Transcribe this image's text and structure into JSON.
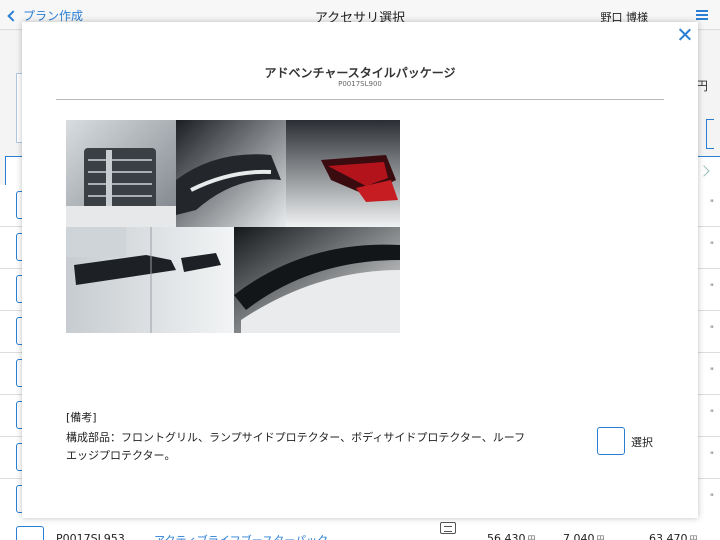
{
  "header": {
    "back_label": "プラン作成",
    "title": "アクセサリ選択",
    "user": "野口 博様"
  },
  "background": {
    "yen_label": "円",
    "row_unit": "\"",
    "bottom_row": {
      "code": "P0017SL953",
      "name": "アクティブライフブースターパック",
      "price1": "56,430",
      "price2": "7,040",
      "price3": "63,470",
      "unit": "円"
    }
  },
  "modal": {
    "title": "アドベンチャースタイルパッケージ",
    "code": "P0017SL900",
    "note_heading": "[備考]",
    "note_body": "構成部品：フロントグリル、ランプサイドプロテクター、ボディサイドプロテクター、ルーフエッジプロテクター。",
    "select_label": "選択"
  },
  "colors": {
    "accent": "#2a7fd4"
  }
}
